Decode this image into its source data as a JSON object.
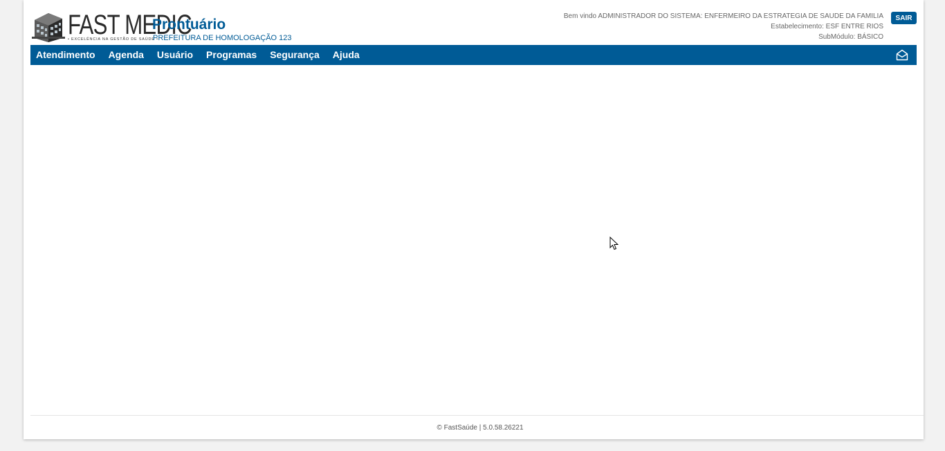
{
  "header": {
    "logo_text": "FAST MEDIC",
    "logo_tagline": "• EXCELÊNCIA NA GESTÃO DE SAÚDE •",
    "app_title": "Prontuário",
    "app_subtitle": "PREFEITURA DE HOMOLOGAÇÃO 123",
    "welcome": "Bem vindo ADMINISTRADOR DO SISTEMA: ENFERMEIRO DA ESTRATEGIA DE SAUDE DA FAMILIA",
    "establishment": "Estabelecimento: ESF ENTRE RIOS",
    "submodule": "SubMódulo: BÁSICO",
    "logout_label": "SAIR"
  },
  "nav": {
    "items": [
      {
        "label": "Atendimento"
      },
      {
        "label": "Agenda"
      },
      {
        "label": "Usuário"
      },
      {
        "label": "Programas"
      },
      {
        "label": "Segurança"
      },
      {
        "label": "Ajuda"
      }
    ],
    "mail_icon": "envelope-open-icon"
  },
  "footer": {
    "text": "© FastSaúde | 5.0.58.26221"
  },
  "colors": {
    "primary": "#005b96",
    "background": "#f2f2f2"
  }
}
